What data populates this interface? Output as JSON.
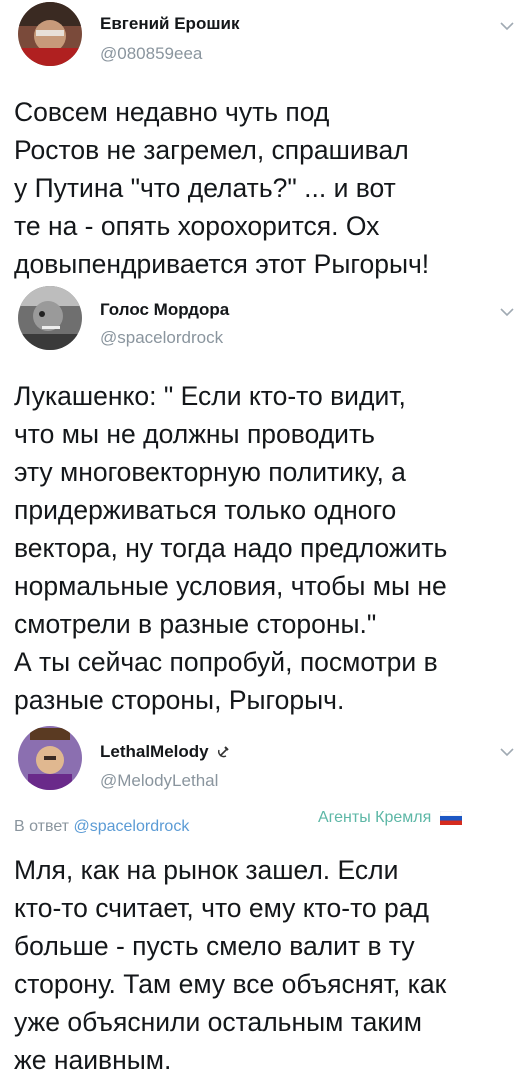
{
  "tweets": [
    {
      "name": "Евгений Ерошик",
      "handle": "@080859eea",
      "text": "Совсем недавно чуть под\nРостов не загремел, спрашивал\nу Путина \"что делать?\" ... и вот\nте на - опять хорохорится. Ох\nдовыпендривается этот Рыгорыч!"
    },
    {
      "name": "Голос Мордора",
      "handle": "@spacelordrock",
      "text": "Лукашенко: \" Если кто-то видит,\nчто мы не должны проводить\nэту многовекторную политику, а\nпридерживаться только одного\nвектора, ну тогда надо предложить\nнормальные условия, чтобы мы не\nсмотрели в разные стороны.\"\nА ты сейчас попробуй, посмотри в\nразные стороны, Рыгорыч."
    },
    {
      "name": "LethalMelody",
      "name_icon": "hammer-sickle-icon",
      "handle": "@MelodyLethal",
      "reply_prefix": "В ответ",
      "reply_handle": "@spacelordrock",
      "text": "Мля, как на рынок зашел. Если\nкто-то считает, что ему кто-то рад\nбольше - пусть смело валит в ту\nсторону. Там ему все объяснят, как\nуже объяснили остальным таким\nже наивным."
    }
  ],
  "watermark": {
    "text": "Агенты Кремля",
    "flag_icon": "russian-flag-icon",
    "color": "#5db7a6"
  },
  "colors": {
    "text": "#14171a",
    "muted": "#8a959e",
    "link": "#5b9bd5"
  }
}
